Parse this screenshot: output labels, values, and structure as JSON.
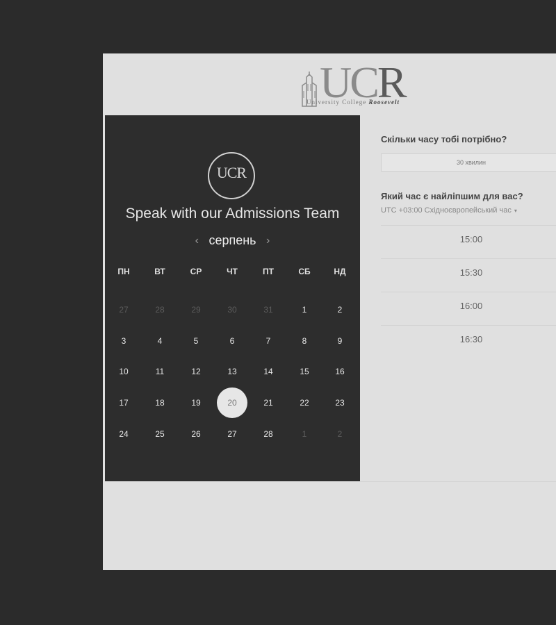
{
  "logo": {
    "word_left": "UC",
    "word_right": "R",
    "sub": "University College ",
    "sub_emph": "Roosevelt"
  },
  "calendar": {
    "badge": "UCR",
    "title": "Speak with our Admissions Team",
    "month": "серпень",
    "prev_icon": "‹",
    "next_icon": "›",
    "weekdays": [
      "ПН",
      "ВТ",
      "СР",
      "ЧТ",
      "ПТ",
      "СБ",
      "НД"
    ],
    "weeks": [
      [
        {
          "d": "27",
          "m": true
        },
        {
          "d": "28",
          "m": true
        },
        {
          "d": "29",
          "m": true
        },
        {
          "d": "30",
          "m": true
        },
        {
          "d": "31",
          "m": true
        },
        {
          "d": "1"
        },
        {
          "d": "2"
        }
      ],
      [
        {
          "d": "3"
        },
        {
          "d": "4"
        },
        {
          "d": "5"
        },
        {
          "d": "6"
        },
        {
          "d": "7"
        },
        {
          "d": "8"
        },
        {
          "d": "9"
        }
      ],
      [
        {
          "d": "10"
        },
        {
          "d": "11"
        },
        {
          "d": "12"
        },
        {
          "d": "13"
        },
        {
          "d": "14"
        },
        {
          "d": "15"
        },
        {
          "d": "16"
        }
      ],
      [
        {
          "d": "17"
        },
        {
          "d": "18"
        },
        {
          "d": "19"
        },
        {
          "d": "20",
          "s": true
        },
        {
          "d": "21"
        },
        {
          "d": "22"
        },
        {
          "d": "23"
        }
      ],
      [
        {
          "d": "24"
        },
        {
          "d": "25"
        },
        {
          "d": "26"
        },
        {
          "d": "27"
        },
        {
          "d": "28"
        },
        {
          "d": "1",
          "m": true
        },
        {
          "d": "2",
          "m": true
        }
      ]
    ]
  },
  "scheduler": {
    "duration_question": "Скільки часу тобі потрібно?",
    "duration_value": "30 хвилин",
    "time_question": "Який час є найліпшим для вас?",
    "timezone": "UTC +03:00 Східноєвропейський час",
    "timezone_caret": "▾",
    "slots": [
      "15:00",
      "15:30",
      "16:00",
      "16:30"
    ]
  },
  "colors": {
    "background": "#2b2b2b",
    "page": "#e0e0e0",
    "calendar": "#2d2d2d",
    "selected": "#e6e6e6"
  }
}
